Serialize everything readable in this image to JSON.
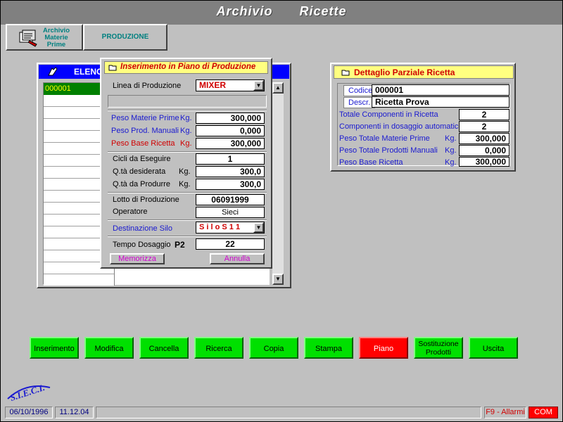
{
  "app": {
    "title_part1": "Archivio",
    "title_part2": "Ricette"
  },
  "toolbar": {
    "archive_button": "Archivio Materie Prime",
    "production_button": "PRODUZIONE"
  },
  "list_window": {
    "title": "ELENC",
    "rows": [
      "000001"
    ]
  },
  "dialog": {
    "title": "Inserimento in Piano di Produzione",
    "linea_label": "Linea di Produzione",
    "linea_value": "MIXER",
    "peso_mp_label": "Peso Materie Prime",
    "peso_mp_unit": "Kg.",
    "peso_mp_value": "300,000",
    "peso_pm_label": "Peso Prod. Manuali",
    "peso_pm_unit": "Kg.",
    "peso_pm_value": "0,000",
    "peso_base_label": "Peso Base Ricetta",
    "peso_base_unit": "Kg.",
    "peso_base_value": "300,000",
    "cicli_label": "Cicli da Eseguire",
    "cicli_value": "1",
    "qta_des_label": "Q.tà desiderata",
    "qta_des_unit": "Kg.",
    "qta_des_value": "300,0",
    "qta_prod_label": "Q.tà da Produrre",
    "qta_prod_unit": "Kg.",
    "qta_prod_value": "300,0",
    "lotto_label": "Lotto di Produzione",
    "lotto_value": "06091999",
    "operatore_label": "Operatore",
    "operatore_value": "Sieci",
    "dest_label": "Destinazione  Silo",
    "dest_value": "S i l o   S 1 1",
    "tempo_label": "Tempo Dosaggio",
    "tempo_tag": "P2",
    "tempo_value": "22",
    "memorizza": "Memorizza",
    "annulla": "Annulla"
  },
  "detail": {
    "title": "Dettaglio Parziale Ricetta",
    "codice_label": "Codice",
    "codice_value": "000001",
    "descr_label": "Descr.",
    "descr_value": "Ricetta Prova",
    "tot_comp_label": "Totale  Componenti  in  Ricetta",
    "tot_comp_value": "2",
    "comp_auto_label": "Componenti in dosaggio automatico",
    "comp_auto_value": "2",
    "peso_mp_label": "Peso Totale Materie Prime",
    "peso_mp_unit": "Kg.",
    "peso_mp_value": "300,000",
    "peso_pm_label": "Peso Totale Prodotti Manuali",
    "peso_pm_unit": "Kg.",
    "peso_pm_value": "0,000",
    "peso_base_label": "Peso  Base  Ricetta",
    "peso_base_unit": "Kg.",
    "peso_base_value": "300,000"
  },
  "actions": [
    "Inserimento",
    "Modifica",
    "Cancella",
    "Ricerca",
    "Copia",
    "Stampa",
    "Piano",
    "Sostituzione Prodotti",
    "Uscita"
  ],
  "logo": "S.I.E.C.I.",
  "statusbar": {
    "date": "06/10/1996",
    "time": "11.12.04",
    "alarms": "F9 - Allarmi",
    "com": "COM"
  },
  "colors": {
    "green_button": "#00e000",
    "red_button": "#ff0000",
    "dialog_title_bg": "#ffff80",
    "title_bar": "#808080",
    "list_header": "#0000ff"
  }
}
